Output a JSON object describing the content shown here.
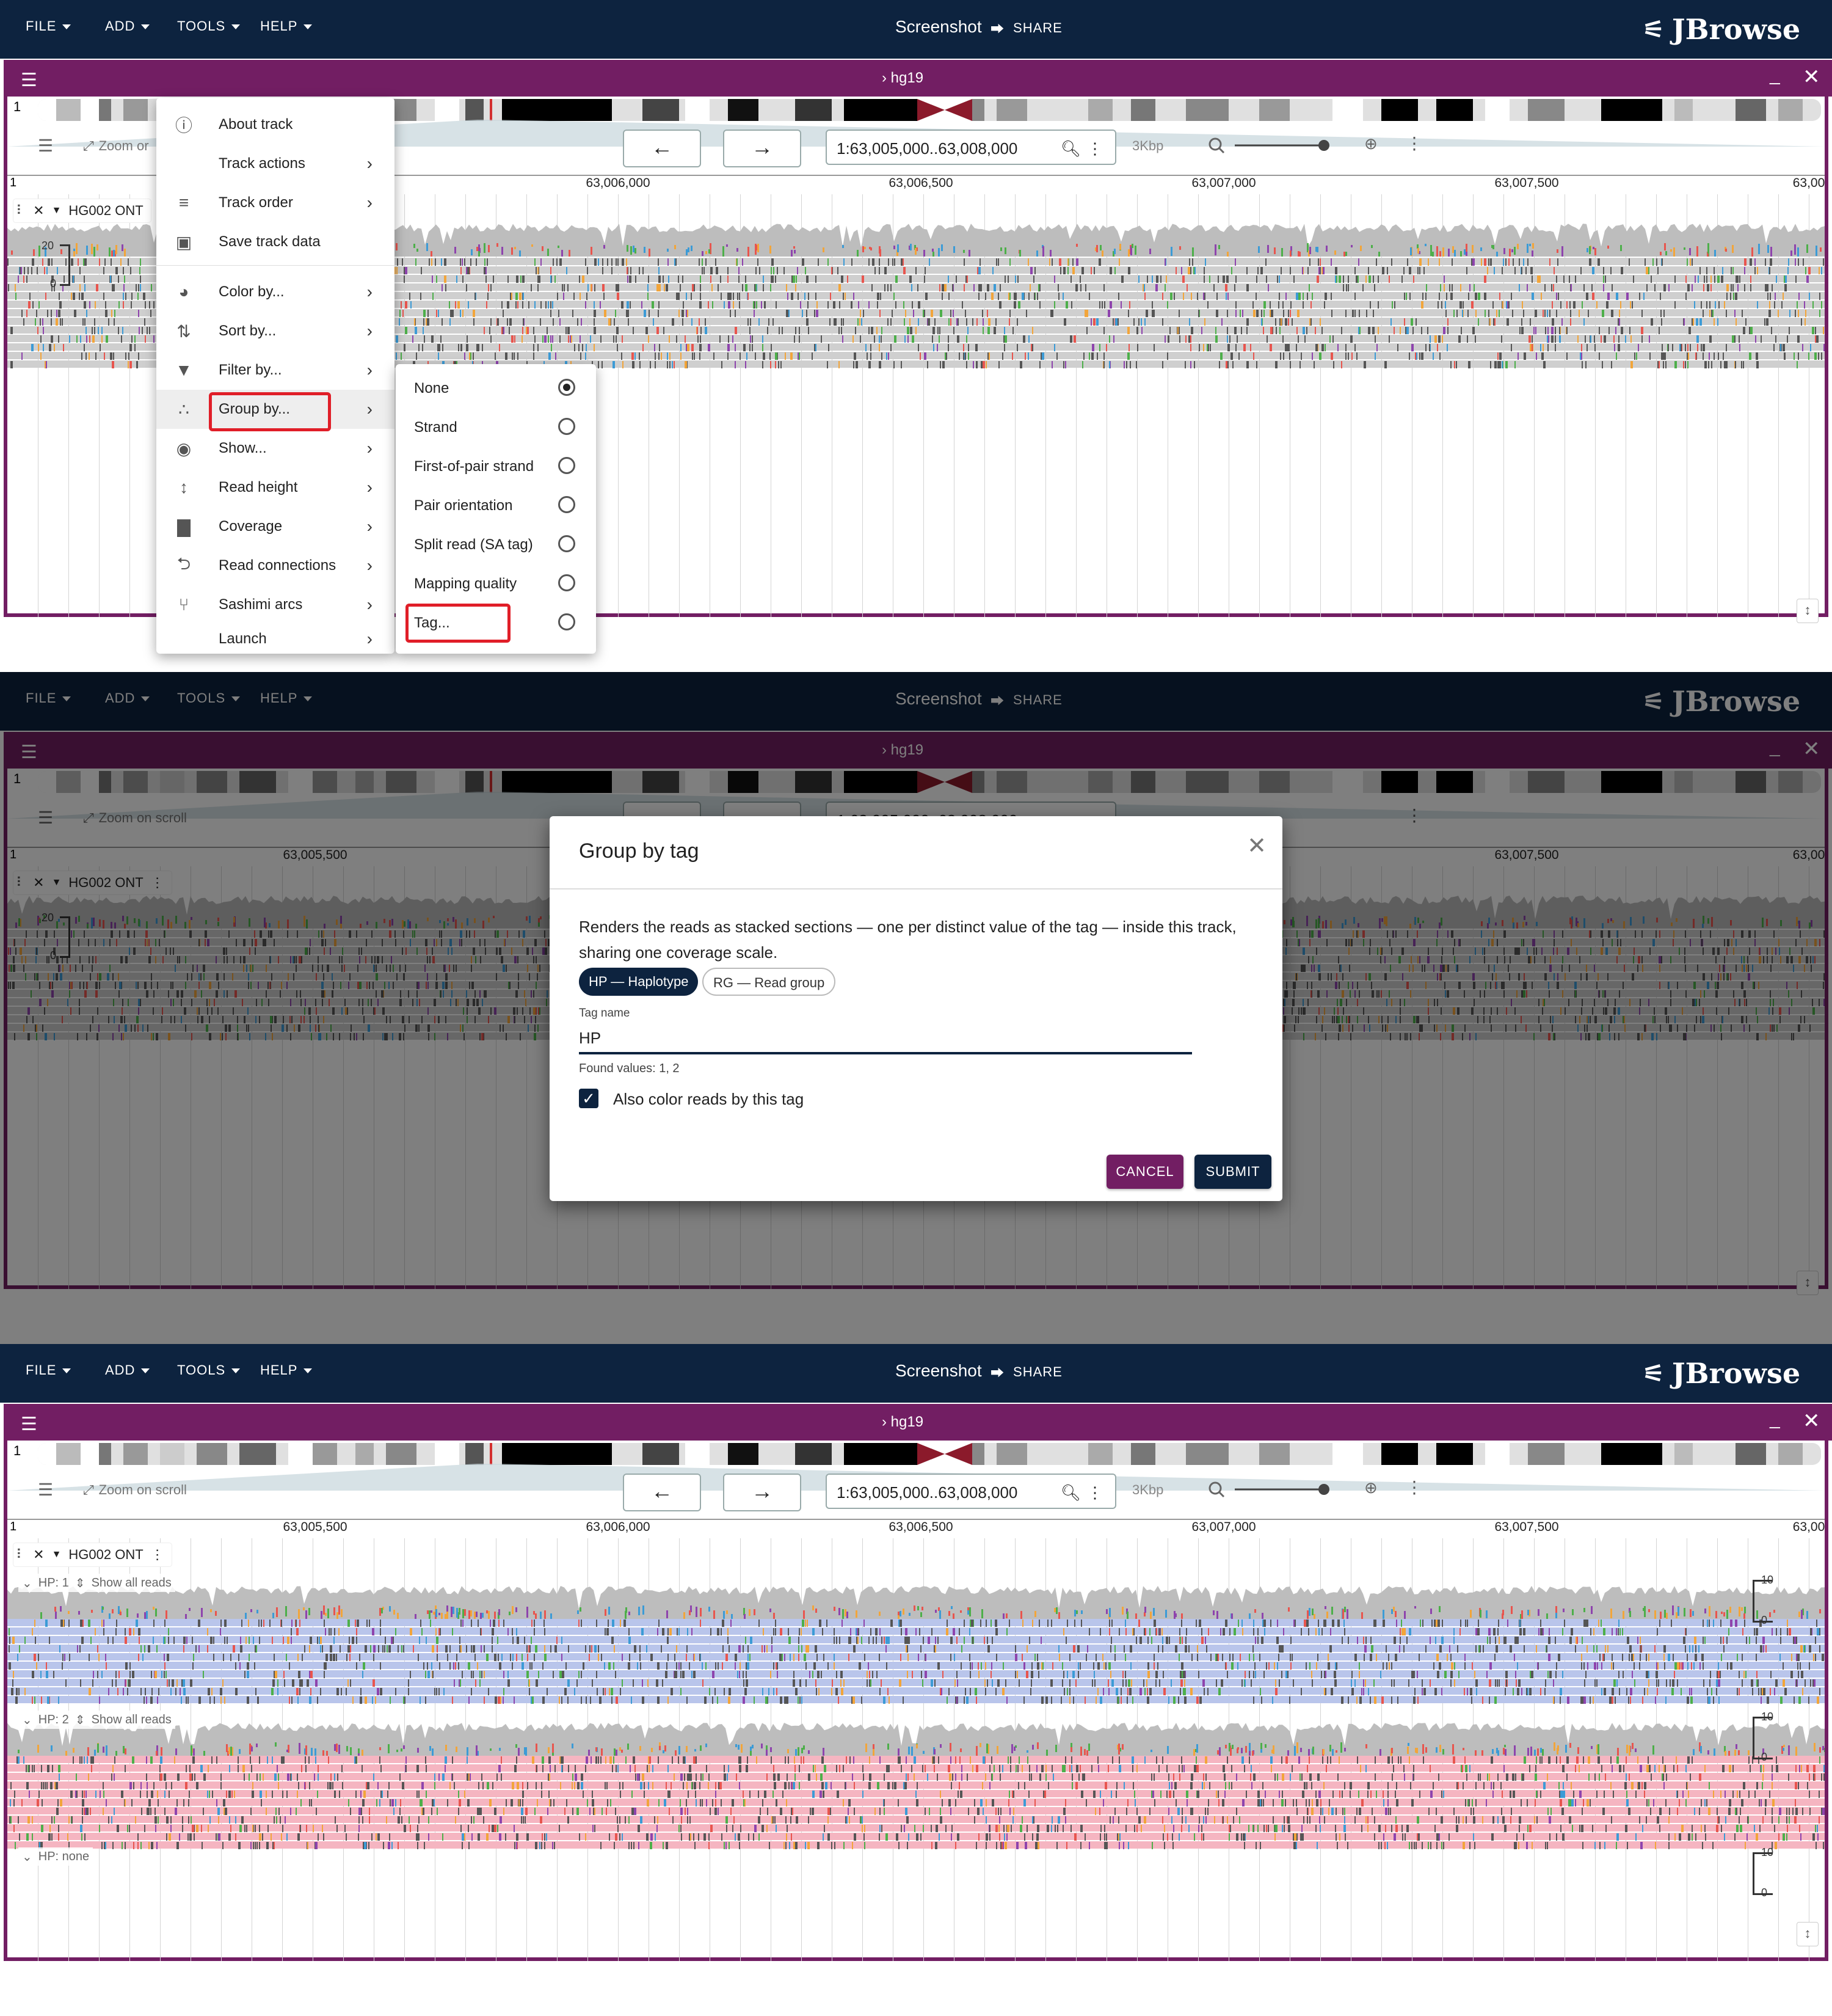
{
  "appbar": {
    "menus": [
      "FILE",
      "ADD",
      "TOOLS",
      "HELP"
    ],
    "title": "Screenshot",
    "share": "SHARE",
    "logo": "JBrowse"
  },
  "view": {
    "assembly": "hg19",
    "chrom": "1",
    "zoom_on_scroll": "Zoom on scroll",
    "zoom_on_scroll_partial": "Zoom or",
    "location": "1:63,005,000..63,008,000",
    "span": "3Kbp",
    "ruler_ticks": [
      "63,005,500",
      "63,006,000",
      "63,006,500",
      "63,007,000",
      "63,007,500",
      "63,00"
    ],
    "ruler_start": "1",
    "track_name": "HG002 ONT",
    "cov_max": "20",
    "cov_min": "0"
  },
  "track_menu": {
    "items": [
      {
        "label": "About track",
        "icon": "info-icon",
        "arrow": false
      },
      {
        "label": "Track actions",
        "icon": "none",
        "arrow": true
      },
      {
        "label": "Track order",
        "icon": "track-order-icon",
        "arrow": true
      },
      {
        "label": "Save track data",
        "icon": "save-icon",
        "arrow": false
      },
      {
        "label": "Color by...",
        "icon": "palette-icon",
        "arrow": true
      },
      {
        "label": "Sort by...",
        "icon": "sort-icon",
        "arrow": true
      },
      {
        "label": "Filter by...",
        "icon": "filter-icon",
        "arrow": true
      },
      {
        "label": "Group by...",
        "icon": "group-icon",
        "arrow": true
      },
      {
        "label": "Show...",
        "icon": "eye-icon",
        "arrow": true
      },
      {
        "label": "Read height",
        "icon": "height-icon",
        "arrow": true
      },
      {
        "label": "Coverage",
        "icon": "bar-chart-icon",
        "arrow": true
      },
      {
        "label": "Read connections",
        "icon": "connections-icon",
        "arrow": true
      },
      {
        "label": "Sashimi arcs",
        "icon": "arcs-icon",
        "arrow": true
      },
      {
        "label": "Launch",
        "icon": "none",
        "arrow": true
      }
    ]
  },
  "group_menu": {
    "options": [
      {
        "label": "None",
        "selected": true
      },
      {
        "label": "Strand",
        "selected": false
      },
      {
        "label": "First-of-pair strand",
        "selected": false
      },
      {
        "label": "Pair orientation",
        "selected": false
      },
      {
        "label": "Split read (SA tag)",
        "selected": false
      },
      {
        "label": "Mapping quality",
        "selected": false
      },
      {
        "label": "Tag...",
        "selected": false
      }
    ]
  },
  "dialog": {
    "title": "Group by tag",
    "description": "Renders the reads as stacked sections — one per distinct value of the tag — inside this track, sharing one coverage scale.",
    "chips": [
      "HP — Haplotype",
      "RG — Read group"
    ],
    "tag_label": "Tag name",
    "tag_value": "HP",
    "found_values": "Found values: 1, 2",
    "checkbox_label": "Also color reads by this tag",
    "checkbox_checked": true,
    "cancel": "CANCEL",
    "submit": "SUBMIT"
  },
  "groups": [
    {
      "label": "HP: 1",
      "show_all": "Show all reads",
      "scale_max": "10",
      "scale_min": "0"
    },
    {
      "label": "HP: 2",
      "show_all": "Show all reads",
      "scale_max": "10",
      "scale_min": "0"
    },
    {
      "label": "HP: none",
      "scale_max": "10",
      "scale_min": "0"
    }
  ],
  "colors": {
    "appbar": "#0d233f",
    "view_header": "#721e63",
    "highlight": "#e01e28",
    "hp1_reads": "#b9c5eb",
    "hp2_reads": "#f5b5c1",
    "reads_gray": "#c8c8c8"
  }
}
